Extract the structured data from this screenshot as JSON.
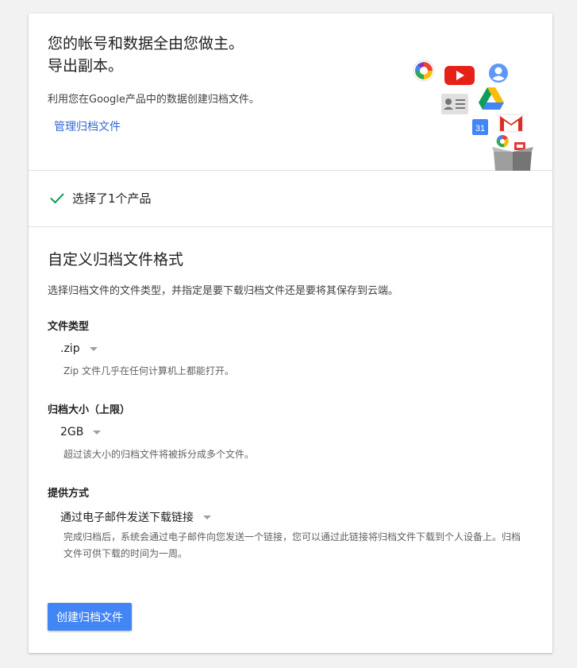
{
  "header": {
    "headline_line1": "您的帐号和数据全由您做主。",
    "headline_line2": "导出副本。",
    "intro": "利用您在Google产品中的数据创建归档文件。",
    "manage_link": "管理归档文件",
    "icons": [
      "picasa-icon",
      "youtube-icon",
      "profile-icon",
      "contacts-icon",
      "drive-icon",
      "calendar-icon",
      "gmail-icon",
      "hangouts-icon",
      "archive-box-icon"
    ],
    "calendar_day": "31"
  },
  "selection": {
    "text": "选择了1个产品",
    "check_color": "#0f9d58"
  },
  "format": {
    "title": "自定义归档文件格式",
    "description": "选择归档文件的文件类型，并指定是要下载归档文件还是要将其保存到云端。",
    "file_type": {
      "label": "文件类型",
      "value": ".zip",
      "hint": "Zip 文件几乎在任何计算机上都能打开。"
    },
    "archive_size": {
      "label": "归档大小（上限）",
      "value": "2GB",
      "hint": "超过该大小的归档文件将被拆分成多个文件。"
    },
    "delivery": {
      "label": "提供方式",
      "value": "通过电子邮件发送下载链接",
      "hint": "完成归档后，系统会通过电子邮件向您发送一个链接，您可以通过此链接将归档文件下载到个人设备上。归档文件可供下载的时间为一周。"
    },
    "create_button": "创建归档文件"
  },
  "colors": {
    "accent": "#4285f4",
    "link": "#3367d6"
  }
}
